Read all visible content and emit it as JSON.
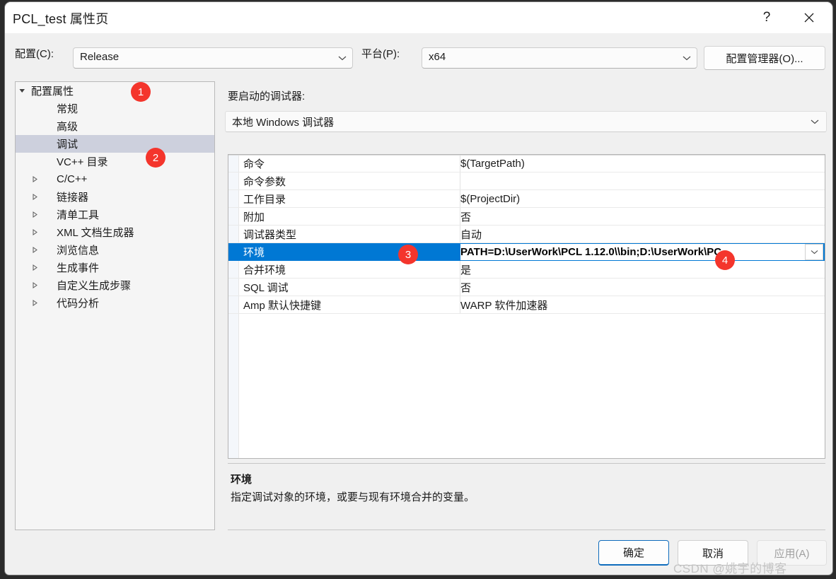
{
  "window": {
    "title": "PCL_test 属性页",
    "help_icon": "?",
    "close_icon": "close-icon"
  },
  "configbar": {
    "config_label": "配置(C):",
    "config_value": "Release",
    "platform_label": "平台(P):",
    "platform_value": "x64",
    "config_manager_button": "配置管理器(O)..."
  },
  "tree": {
    "items": [
      {
        "label": "配置属性",
        "level": 0,
        "expander": "down",
        "selected": false
      },
      {
        "label": "常规",
        "level": 1,
        "expander": "none",
        "selected": false
      },
      {
        "label": "高级",
        "level": 1,
        "expander": "none",
        "selected": false
      },
      {
        "label": "调试",
        "level": 1,
        "expander": "none",
        "selected": true
      },
      {
        "label": "VC++ 目录",
        "level": 1,
        "expander": "none",
        "selected": false
      },
      {
        "label": "C/C++",
        "level": 1,
        "expander": "right",
        "selected": false
      },
      {
        "label": "链接器",
        "level": 1,
        "expander": "right",
        "selected": false
      },
      {
        "label": "清单工具",
        "level": 1,
        "expander": "right",
        "selected": false
      },
      {
        "label": "XML 文档生成器",
        "level": 1,
        "expander": "right",
        "selected": false
      },
      {
        "label": "浏览信息",
        "level": 1,
        "expander": "right",
        "selected": false
      },
      {
        "label": "生成事件",
        "level": 1,
        "expander": "right",
        "selected": false
      },
      {
        "label": "自定义生成步骤",
        "level": 1,
        "expander": "right",
        "selected": false
      },
      {
        "label": "代码分析",
        "level": 1,
        "expander": "right",
        "selected": false
      }
    ]
  },
  "main": {
    "debugger_caption": "要启动的调试器:",
    "debugger_value": "本地 Windows 调试器",
    "properties": [
      {
        "name": "命令",
        "value": "$(TargetPath)",
        "selected": false
      },
      {
        "name": "命令参数",
        "value": "",
        "selected": false
      },
      {
        "name": "工作目录",
        "value": "$(ProjectDir)",
        "selected": false
      },
      {
        "name": "附加",
        "value": "否",
        "selected": false
      },
      {
        "name": "调试器类型",
        "value": "自动",
        "selected": false
      },
      {
        "name": "环境",
        "value": "PATH=D:\\UserWork\\PCL 1.12.0\\\\bin;D:\\UserWork\\PC",
        "selected": true
      },
      {
        "name": "合并环境",
        "value": "是",
        "selected": false
      },
      {
        "name": "SQL 调试",
        "value": "否",
        "selected": false
      },
      {
        "name": "Amp 默认快捷键",
        "value": "WARP 软件加速器",
        "selected": false
      }
    ]
  },
  "description": {
    "title": "环境",
    "body": "指定调试对象的环境，或要与现有环境合并的变量。"
  },
  "footer": {
    "ok": "确定",
    "cancel": "取消",
    "apply": "应用(A)"
  },
  "watermark": "CSDN @姚宇的博客",
  "annotations": [
    {
      "number": "1"
    },
    {
      "number": "2"
    },
    {
      "number": "3"
    },
    {
      "number": "4"
    }
  ],
  "colors": {
    "accent": "#0078d4",
    "badge": "#f4352c",
    "tree_selected": "#cdd0dd",
    "window_bg": "#f0f0f0"
  }
}
